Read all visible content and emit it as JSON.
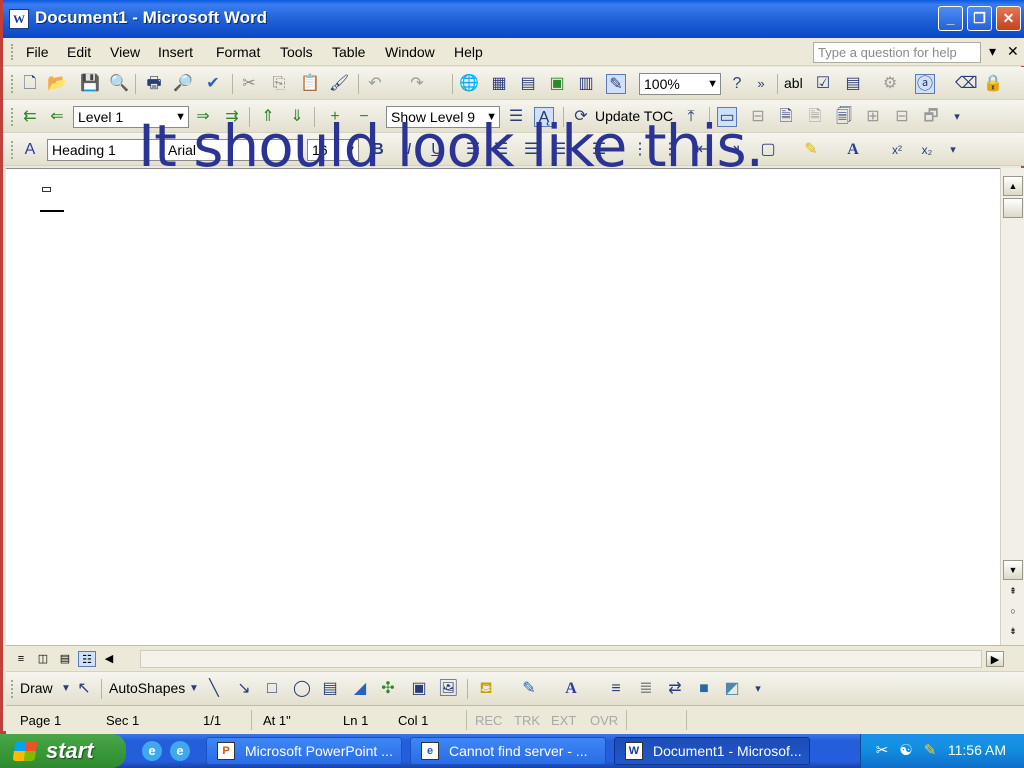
{
  "window": {
    "title": "Document1 - Microsoft Word",
    "app_icon": "word-icon",
    "controls": [
      "minimize-icon",
      "restore-icon",
      "close-icon"
    ]
  },
  "menubar": {
    "items": [
      "File",
      "Edit",
      "View",
      "Insert",
      "Format",
      "Tools",
      "Table",
      "Window",
      "Help"
    ],
    "help_placeholder": "Type a question for help"
  },
  "standard_toolbar": {
    "zoom": "100%",
    "abl_label": "abl"
  },
  "outline_toolbar": {
    "level": "Level 1",
    "show_level": "Show Level 9",
    "update_toc": "Update TOC"
  },
  "formatting_toolbar": {
    "style": "Heading 1",
    "font": "Arial",
    "size": "16"
  },
  "overlay_text": "It should look like this.",
  "drawing_toolbar": {
    "draw": "Draw",
    "autoshapes": "AutoShapes"
  },
  "statusbar": {
    "page": "Page 1",
    "sec": "Sec 1",
    "pages": "1/1",
    "at": "At 1\"",
    "ln": "Ln 1",
    "col": "Col 1",
    "rec": "REC",
    "trk": "TRK",
    "ext": "EXT",
    "ovr": "OVR"
  },
  "taskbar": {
    "start": "start",
    "tasks": [
      {
        "label": "Microsoft PowerPoint ...",
        "icon": "powerpoint-icon"
      },
      {
        "label": "Cannot find server - ...",
        "icon": "ie-icon"
      },
      {
        "label": "Document1 - Microsof...",
        "icon": "word-icon"
      }
    ],
    "time": "11:56 AM"
  }
}
